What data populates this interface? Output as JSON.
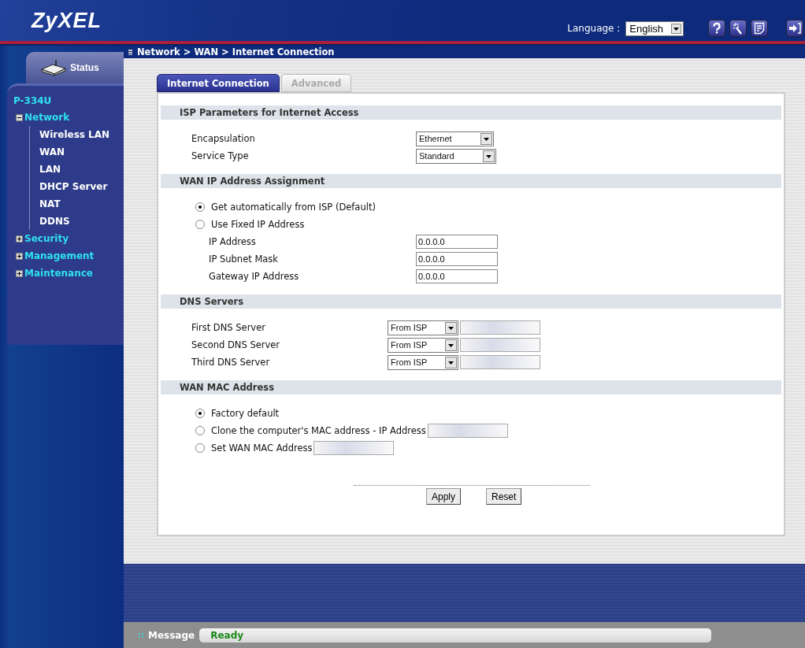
{
  "header": {
    "logo": "ZyXEL",
    "language_label": "Language :",
    "language": "English"
  },
  "breadcrumb": "Network > WAN > Internet Connection",
  "sidebar": {
    "status_tab": "Status",
    "device": "P-334U",
    "tree": [
      {
        "label": "Network",
        "expanded": true,
        "children": [
          {
            "label": "Wireless LAN"
          },
          {
            "label": "WAN"
          },
          {
            "label": "LAN"
          },
          {
            "label": "DHCP Server"
          },
          {
            "label": "NAT"
          },
          {
            "label": "DDNS"
          }
        ]
      },
      {
        "label": "Security",
        "expanded": false
      },
      {
        "label": "Management",
        "expanded": false
      },
      {
        "label": "Maintenance",
        "expanded": false
      }
    ]
  },
  "tabs": [
    {
      "label": "Internet Connection",
      "selected": true
    },
    {
      "label": "Advanced",
      "selected": false
    }
  ],
  "sections": [
    {
      "title": "ISP Parameters for Internet Access",
      "rows": [
        {
          "kind": "select",
          "label": "Encapsulation",
          "value": "Ethernet"
        },
        {
          "kind": "select",
          "label": "Service Type",
          "value": "Standard"
        }
      ]
    },
    {
      "title": "WAN IP Address Assignment",
      "rows": [
        {
          "kind": "radio",
          "label": "Get automatically from ISP (Default)",
          "selected": true
        },
        {
          "kind": "radio",
          "label": "Use Fixed IP Address",
          "selected": false
        },
        {
          "kind": "text",
          "label": "IP Address",
          "value": "0.0.0.0"
        },
        {
          "kind": "text",
          "label": "IP Subnet Mask",
          "value": "0.0.0.0"
        },
        {
          "kind": "text",
          "label": "Gateway IP Address",
          "value": "0.0.0.0"
        }
      ]
    },
    {
      "title": "DNS Servers",
      "rows": [
        {
          "kind": "dns",
          "label": "First DNS Server",
          "value": "From ISP"
        },
        {
          "kind": "dns",
          "label": "Second DNS Server",
          "value": "From ISP"
        },
        {
          "kind": "dns",
          "label": "Third DNS Server",
          "value": "From ISP"
        }
      ]
    },
    {
      "title": "WAN MAC Address",
      "rows": [
        {
          "kind": "radio",
          "label": "Factory default",
          "selected": true
        },
        {
          "kind": "radio-field",
          "label": "Clone the computer's MAC address - IP Address",
          "selected": false
        },
        {
          "kind": "radio-field",
          "label": "Set WAN MAC Address",
          "selected": false
        }
      ]
    }
  ],
  "buttons": [
    "Apply",
    "Reset"
  ],
  "status": {
    "label": "Message",
    "text": "Ready"
  }
}
